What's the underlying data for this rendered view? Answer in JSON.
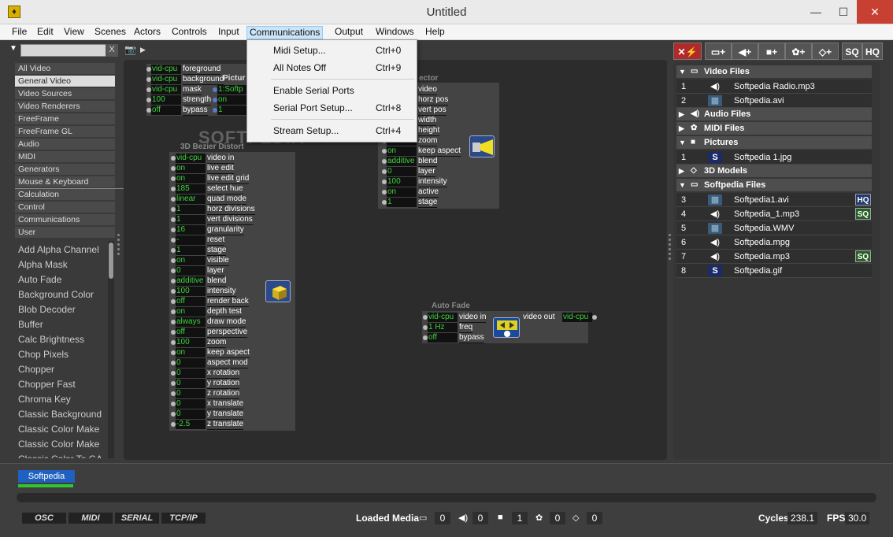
{
  "window": {
    "title": "Untitled",
    "minimize": "—",
    "maximize": "☐",
    "close": "✕"
  },
  "menu": [
    "File",
    "Edit",
    "View",
    "Scenes",
    "Actors",
    "Controls",
    "Input",
    "Communications",
    "Output",
    "Windows",
    "Help"
  ],
  "comm_menu": [
    {
      "label": "Midi Setup...",
      "shortcut": "Ctrl+0"
    },
    {
      "label": "All Notes Off",
      "shortcut": "Ctrl+9"
    },
    {
      "label": "Enable Serial Ports",
      "shortcut": ""
    },
    {
      "label": "Serial Port Setup...",
      "shortcut": "Ctrl+8"
    },
    {
      "label": "Stream Setup...",
      "shortcut": "Ctrl+4"
    }
  ],
  "search": {
    "clear": "X"
  },
  "categories": [
    "All Video",
    "General Video",
    "Video Sources",
    "Video Renderers",
    "FreeFrame",
    "FreeFrame GL",
    "Audio",
    "MIDI",
    "Generators",
    "Mouse & Keyboard",
    "Calculation",
    "Control",
    "Communications",
    "User"
  ],
  "actors_list": [
    "Add Alpha Channel",
    "Alpha Mask",
    "Auto Fade",
    "Background Color",
    "Blob Decoder",
    "Buffer",
    "Calc Brightness",
    "Chop Pixels",
    "Chopper",
    "Chopper Fast",
    "Chroma Key",
    "Classic Background",
    "Classic Color Make",
    "Classic Color Make",
    "Classic Color To GA"
  ],
  "watermark": "SOFTPEDIA",
  "picture_player": {
    "title": "Pictur",
    "props": [
      {
        "val": "vid-cpu",
        "name": "foreground"
      },
      {
        "val": "vid-cpu",
        "name": "background"
      },
      {
        "val": "vid-cpu",
        "name": "mask"
      },
      {
        "val": "100",
        "name": "strength"
      },
      {
        "val": "off",
        "name": "bypass"
      }
    ],
    "extra": [
      {
        "val": "1:Softp"
      },
      {
        "val": "on"
      },
      {
        "val": "1"
      }
    ]
  },
  "projector": {
    "title": "ector",
    "props": [
      {
        "val": "",
        "name": "video"
      },
      {
        "val": "",
        "name": "horz pos"
      },
      {
        "val": "",
        "name": "vert pos"
      },
      {
        "val": "",
        "name": "width"
      },
      {
        "val": "",
        "name": "height"
      },
      {
        "val": "100",
        "name": "zoom"
      },
      {
        "val": "on",
        "name": "keep aspect"
      },
      {
        "val": "additive",
        "name": "blend"
      },
      {
        "val": "0",
        "name": "layer"
      },
      {
        "val": "100",
        "name": "intensity"
      },
      {
        "val": "on",
        "name": "active"
      },
      {
        "val": "1",
        "name": "stage"
      }
    ]
  },
  "bezier": {
    "title": "3D Bezier Distort",
    "props": [
      {
        "val": "vid-cpu",
        "name": "video in"
      },
      {
        "val": "on",
        "name": "live edit"
      },
      {
        "val": "on",
        "name": "live edit grid"
      },
      {
        "val": "185",
        "name": "select hue"
      },
      {
        "val": "linear",
        "name": "quad mode"
      },
      {
        "val": "1",
        "name": "horz divisions"
      },
      {
        "val": "1",
        "name": "vert divisions"
      },
      {
        "val": "16",
        "name": "granularity"
      },
      {
        "val": "-",
        "name": "reset"
      },
      {
        "val": "1",
        "name": "stage"
      },
      {
        "val": "on",
        "name": "visible"
      },
      {
        "val": "0",
        "name": "layer"
      },
      {
        "val": "additive",
        "name": "blend"
      },
      {
        "val": "100",
        "name": "intensity"
      },
      {
        "val": "off",
        "name": "render back"
      },
      {
        "val": "on",
        "name": "depth test"
      },
      {
        "val": "always",
        "name": "draw mode"
      },
      {
        "val": "off",
        "name": "perspective"
      },
      {
        "val": "100",
        "name": "zoom"
      },
      {
        "val": "on",
        "name": "keep aspect"
      },
      {
        "val": "0",
        "name": "aspect mod"
      },
      {
        "val": "0",
        "name": "x rotation"
      },
      {
        "val": "0",
        "name": "y rotation"
      },
      {
        "val": "0",
        "name": "z rotation"
      },
      {
        "val": "0",
        "name": "x translate"
      },
      {
        "val": "0",
        "name": "y translate"
      },
      {
        "val": "-2.5",
        "name": "z translate"
      }
    ]
  },
  "autofade": {
    "title": "Auto Fade",
    "props": [
      {
        "val": "vid-cpu",
        "name": "video in"
      },
      {
        "val": "1 Hz",
        "name": "freq"
      },
      {
        "val": "off",
        "name": "bypass"
      }
    ],
    "out": {
      "name": "video out",
      "val": "vid-cpu"
    }
  },
  "toolbar": {
    "sq": "SQ",
    "hq": "HQ"
  },
  "media": {
    "sections": [
      {
        "key": "video",
        "title": "Video Files",
        "open": true
      },
      {
        "key": "audio",
        "title": "Audio Files",
        "open": false
      },
      {
        "key": "midi",
        "title": "MIDI Files",
        "open": false
      },
      {
        "key": "pictures",
        "title": "Pictures",
        "open": true
      },
      {
        "key": "models",
        "title": "3D Models",
        "open": false
      },
      {
        "key": "softpedia",
        "title": "Softpedia Files",
        "open": true
      }
    ],
    "video": [
      {
        "num": "1",
        "name": "Softpedia Radio.mp3",
        "icon": "speaker-icon"
      },
      {
        "num": "2",
        "name": "Softpedia.avi",
        "icon": "video-thumb-icon"
      }
    ],
    "pictures": [
      {
        "num": "1",
        "name": "Softpedia 1.jpg",
        "icon": "softpedia-s-icon"
      }
    ],
    "softpedia": [
      {
        "num": "3",
        "name": "Softpedia1.avi",
        "icon": "video-thumb-icon",
        "badge": "HQ"
      },
      {
        "num": "4",
        "name": "Softpedia_1.mp3",
        "icon": "speaker-icon",
        "badge": "SQ"
      },
      {
        "num": "5",
        "name": "Softpedia.WMV",
        "icon": "video-thumb-icon",
        "badge": ""
      },
      {
        "num": "6",
        "name": "Softpedia.mpg",
        "icon": "speaker-icon",
        "badge": ""
      },
      {
        "num": "7",
        "name": "Softpedia.mp3",
        "icon": "speaker-icon",
        "badge": "SQ"
      },
      {
        "num": "8",
        "name": "Softpedia.gif",
        "icon": "softpedia-s-icon",
        "badge": ""
      }
    ]
  },
  "scene": {
    "name": "Softpedia"
  },
  "status": {
    "buttons": [
      "OSC",
      "MIDI",
      "SERIAL",
      "TCP/IP"
    ],
    "loaded_label": "Loaded Media",
    "counts": [
      "0",
      "0",
      "1",
      "0",
      "0"
    ],
    "cycles_label": "Cycles",
    "cycles": "238.1",
    "fps_label": "FPS",
    "fps": "30.0"
  },
  "colors": {
    "accent": "#2060c0",
    "value_text": "#3dd23d",
    "close": "#c84031"
  }
}
